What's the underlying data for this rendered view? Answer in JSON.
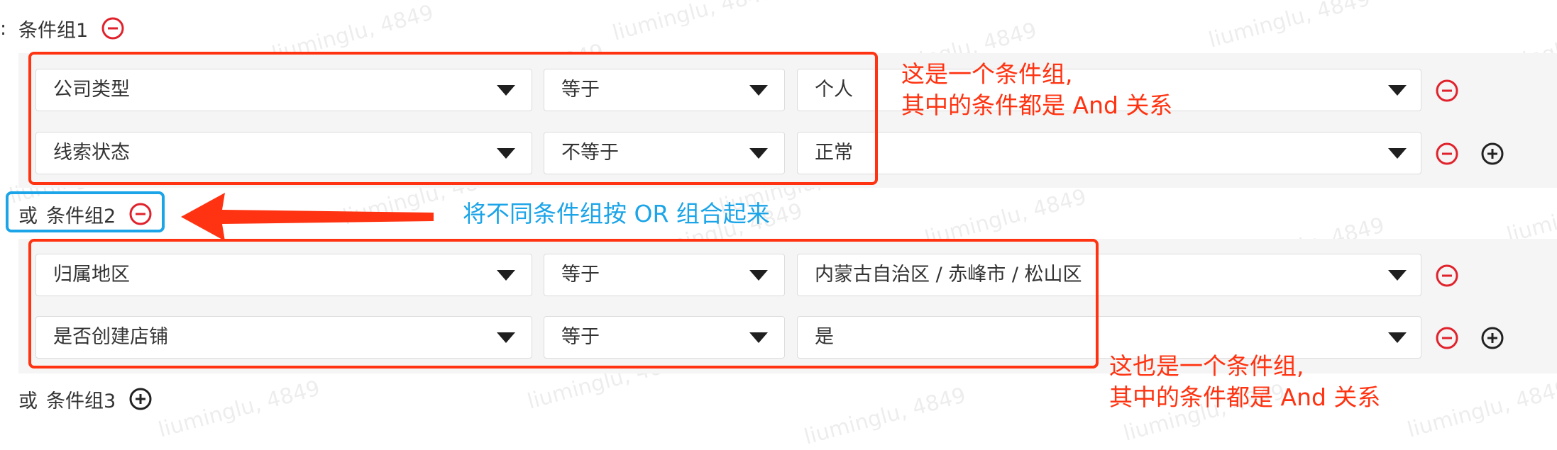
{
  "watermark": "liuminglu, 4849",
  "colors": {
    "annotation_red": "#ff3311",
    "annotation_blue": "#1ba4e8",
    "remove_icon": "#e0222c",
    "add_icon": "#222222",
    "group_bg": "#f5f5f5"
  },
  "groups": [
    {
      "prefix": "",
      "label": "条件组1",
      "action_icon": "remove-circle-icon",
      "conditions": [
        {
          "field": "公司类型",
          "operator": "等于",
          "value": "个人",
          "actions": [
            "remove-circle-icon"
          ]
        },
        {
          "field": "线索状态",
          "operator": "不等于",
          "value": "正常",
          "actions": [
            "remove-circle-icon",
            "add-circle-icon"
          ]
        }
      ]
    },
    {
      "prefix": "或",
      "label": "条件组2",
      "action_icon": "remove-circle-icon",
      "conditions": [
        {
          "field": "归属地区",
          "operator": "等于",
          "value": "内蒙古自治区 / 赤峰市 / 松山区",
          "actions": [
            "remove-circle-icon"
          ]
        },
        {
          "field": "是否创建店铺",
          "operator": "等于",
          "value": "是",
          "actions": [
            "remove-circle-icon",
            "add-circle-icon"
          ]
        }
      ]
    },
    {
      "prefix": "或",
      "label": "条件组3",
      "action_icon": "add-circle-icon",
      "conditions": []
    }
  ],
  "annotations": {
    "group1_note": [
      "这是一个条件组,",
      "其中的条件都是 And 关系"
    ],
    "or_note": "将不同条件组按 OR 组合起来",
    "group2_note": [
      "这也是一个条件组,",
      "其中的条件都是 And 关系"
    ]
  }
}
